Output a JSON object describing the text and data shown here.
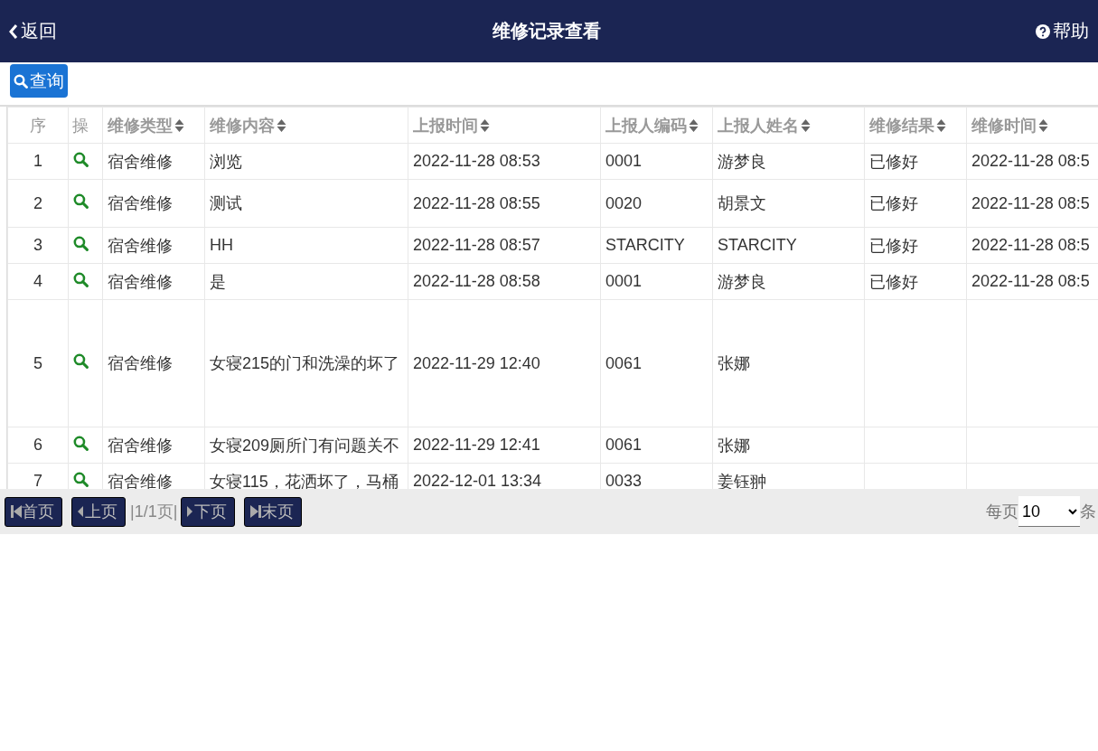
{
  "header": {
    "back": "返回",
    "title": "维修记录查看",
    "help": "帮助"
  },
  "toolbar": {
    "query": "查询"
  },
  "table": {
    "columns": [
      {
        "label": "序",
        "sortable": false
      },
      {
        "label": "操",
        "sortable": false
      },
      {
        "label": "维修类型",
        "sortable": true
      },
      {
        "label": "维修内容",
        "sortable": true
      },
      {
        "label": "上报时间",
        "sortable": true
      },
      {
        "label": "上报人编码",
        "sortable": true
      },
      {
        "label": "上报人姓名",
        "sortable": true
      },
      {
        "label": "维修结果",
        "sortable": true
      },
      {
        "label": "维修时间",
        "sortable": true
      }
    ],
    "rows": [
      {
        "no": "1",
        "type": "宿舍维修",
        "content": "浏览",
        "reported": "2022-11-28 08:53",
        "code": "0001",
        "name": "游梦良",
        "result": "已修好",
        "repaired": "2022-11-28 08:5"
      },
      {
        "no": "2",
        "type": "宿舍维修",
        "content": "测试",
        "reported": "2022-11-28 08:55",
        "code": "0020",
        "name": "胡景文",
        "result": "已修好",
        "repaired": "2022-11-28 08:5"
      },
      {
        "no": "3",
        "type": "宿舍维修",
        "content": "HH",
        "reported": "2022-11-28 08:57",
        "code": "STARCITY",
        "name": "STARCITY",
        "result": "已修好",
        "repaired": "2022-11-28 08:5"
      },
      {
        "no": "4",
        "type": "宿舍维修",
        "content": "是",
        "reported": "2022-11-28 08:58",
        "code": "0001",
        "name": "游梦良",
        "result": "已修好",
        "repaired": "2022-11-28 08:5"
      },
      {
        "no": "5",
        "type": "宿舍维修",
        "content": "女寝215的门和洗澡的坏了",
        "reported": "2022-11-29 12:40",
        "code": "0061",
        "name": "张娜"
      },
      {
        "no": "6",
        "type": "宿舍维修",
        "content": "女寝209厕所门有问题关不",
        "reported": "2022-11-29 12:41",
        "code": "0061",
        "name": "张娜"
      },
      {
        "no": "7",
        "type": "宿舍维修",
        "content": "女寝115，花洒坏了，马桶",
        "reported": "2022-12-01 13:34",
        "code": "0033",
        "name": "姜钰翀"
      }
    ]
  },
  "pager": {
    "first": "首页",
    "prev": "上页",
    "info": "|1/1页|",
    "next": "下页",
    "last": "末页",
    "per_page_label": "每页",
    "per_page": "10",
    "unit": "条"
  }
}
